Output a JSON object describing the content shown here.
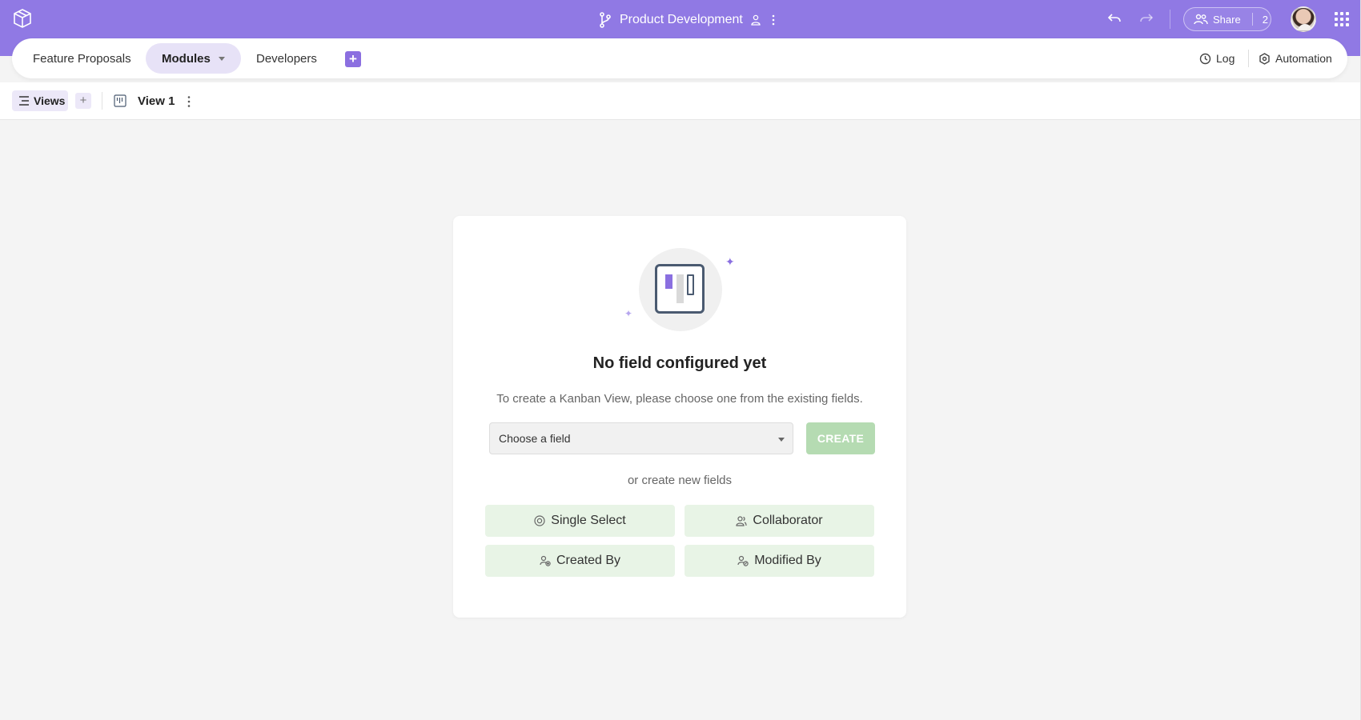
{
  "header": {
    "title": "Product Development",
    "share_label": "Share",
    "share_count": "2",
    "icons": [
      "logo-icon",
      "branch-icon",
      "collaborator-icon",
      "more-vertical-icon",
      "undo-icon",
      "redo-icon",
      "share-users-icon",
      "avatar",
      "apps-grid-icon"
    ]
  },
  "tabs": [
    {
      "label": "Feature Proposals"
    },
    {
      "label": "Modules",
      "active": true
    },
    {
      "label": "Developers"
    }
  ],
  "tab_actions": {
    "add_label": "+",
    "log_label": "Log",
    "automation_label": "Automation"
  },
  "views_bar": {
    "views_label": "Views",
    "add_view_label": "+",
    "current_view": "View 1"
  },
  "empty_state": {
    "title": "No field configured yet",
    "description": "To create a Kanban View, please choose one from the existing fields.",
    "select_placeholder": "Choose a field",
    "create_label": "CREATE",
    "or_text": "or create new fields",
    "field_types": [
      {
        "label": "Single Select",
        "icon": "single-select-icon"
      },
      {
        "label": "Collaborator",
        "icon": "collaborator-icon"
      },
      {
        "label": "Created By",
        "icon": "created-by-icon"
      },
      {
        "label": "Modified By",
        "icon": "modified-by-icon"
      }
    ]
  },
  "colors": {
    "header_bg": "#9079e4",
    "accent": "#8b6fe0",
    "create_button": "#b5dbb2",
    "field_button": "#e8f4e6",
    "page_bg": "#f4f4f4"
  }
}
